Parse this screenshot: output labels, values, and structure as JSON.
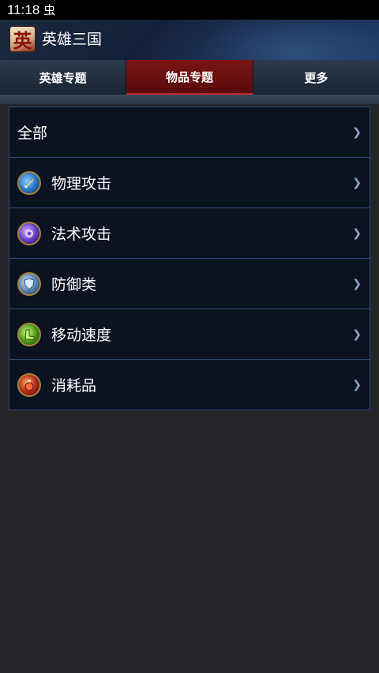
{
  "status_bar": {
    "time": "11:18",
    "notification_glyph": "虫"
  },
  "header": {
    "logo_char": "英",
    "title": "英雄三国"
  },
  "tabs": [
    {
      "label": "英雄专题",
      "active": false
    },
    {
      "label": "物品专题",
      "active": true
    },
    {
      "label": "更多",
      "active": false
    }
  ],
  "menu": {
    "items": [
      {
        "label": "全部",
        "icon": ""
      },
      {
        "label": "物理攻击",
        "icon": "sword-icon"
      },
      {
        "label": "法术攻击",
        "icon": "magic-orb-icon"
      },
      {
        "label": "防御类",
        "icon": "shield-icon"
      },
      {
        "label": "移动速度",
        "icon": "boots-icon"
      },
      {
        "label": "消耗品",
        "icon": "potion-icon"
      }
    ],
    "chevron": "❯"
  },
  "colors": {
    "accent_red": "#7a1414",
    "border_blue": "#2f4d7a",
    "background": "#232529"
  }
}
